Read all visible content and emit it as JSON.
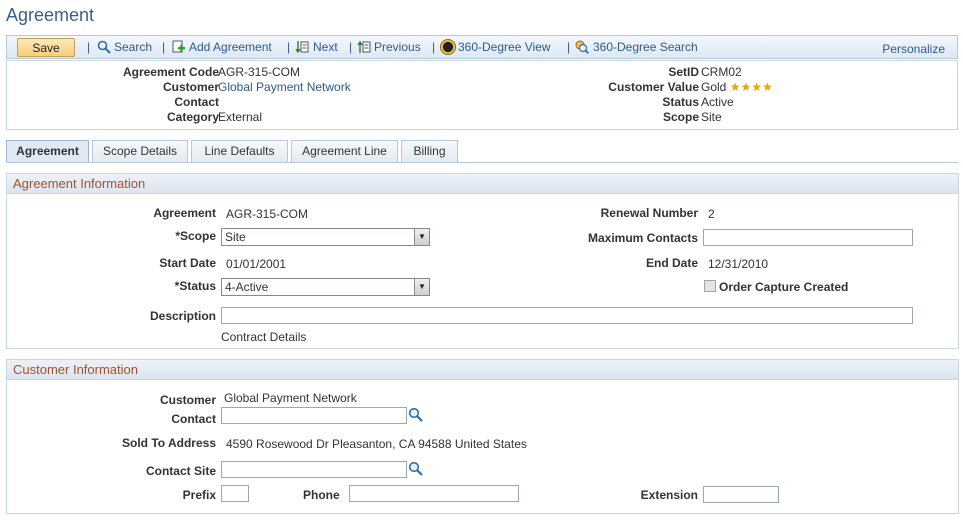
{
  "page": {
    "title": "Agreement"
  },
  "toolbar": {
    "save_label": "Save",
    "search_label": "Search",
    "add_label": "Add Agreement",
    "next_label": "Next",
    "previous_label": "Previous",
    "view360_label": "360-Degree View",
    "search360_label": "360-Degree Search",
    "personalize_label": "Personalize",
    "separator": "|"
  },
  "header": {
    "agreement_code": {
      "label": "Agreement Code",
      "value": "AGR-315-COM"
    },
    "customer": {
      "label": "Customer",
      "value": "Global Payment Network"
    },
    "contact": {
      "label": "Contact",
      "value": ""
    },
    "category": {
      "label": "Category",
      "value": "External"
    },
    "setid": {
      "label": "SetID",
      "value": "CRM02"
    },
    "customer_value": {
      "label": "Customer Value",
      "value": "Gold",
      "stars": "★★★★"
    },
    "status": {
      "label": "Status",
      "value": "Active"
    },
    "scope": {
      "label": "Scope",
      "value": "Site"
    }
  },
  "tabs": [
    {
      "label": "Agreement",
      "active": true
    },
    {
      "label": "Scope Details",
      "active": false
    },
    {
      "label": "Line Defaults",
      "active": false
    },
    {
      "label": "Agreement Line",
      "active": false
    },
    {
      "label": "Billing",
      "active": false
    }
  ],
  "agreement_info": {
    "title": "Agreement Information",
    "agreement": {
      "label": "Agreement",
      "value": "AGR-315-COM"
    },
    "scope": {
      "label": "*Scope",
      "value": "Site"
    },
    "start_date": {
      "label": "Start Date",
      "value": "01/01/2001"
    },
    "status": {
      "label": "*Status",
      "value": "4-Active"
    },
    "description": {
      "label": "Description",
      "value": ""
    },
    "contract_details_link": "Contract Details",
    "renewal_number": {
      "label": "Renewal Number",
      "value": "2"
    },
    "max_contacts": {
      "label": "Maximum Contacts",
      "value": ""
    },
    "end_date": {
      "label": "End Date",
      "value": "12/31/2010"
    },
    "order_capture": {
      "label": "Order Capture Created",
      "checked": false
    }
  },
  "customer_info": {
    "title": "Customer Information",
    "customer": {
      "label": "Customer",
      "value": "Global Payment Network"
    },
    "contact": {
      "label": "Contact",
      "value": ""
    },
    "sold_to_address": {
      "label": "Sold To Address",
      "value": "4590 Rosewood Dr Pleasanton, CA 94588 United States"
    },
    "contact_site": {
      "label": "Contact Site",
      "value": ""
    },
    "prefix": {
      "label": "Prefix",
      "value": ""
    },
    "phone": {
      "label": "Phone",
      "value": ""
    },
    "extension": {
      "label": "Extension",
      "value": ""
    }
  },
  "colors": {
    "accent": "#2e5b8f",
    "section_title": "#a0522d",
    "save_button": "#f6cf79"
  }
}
